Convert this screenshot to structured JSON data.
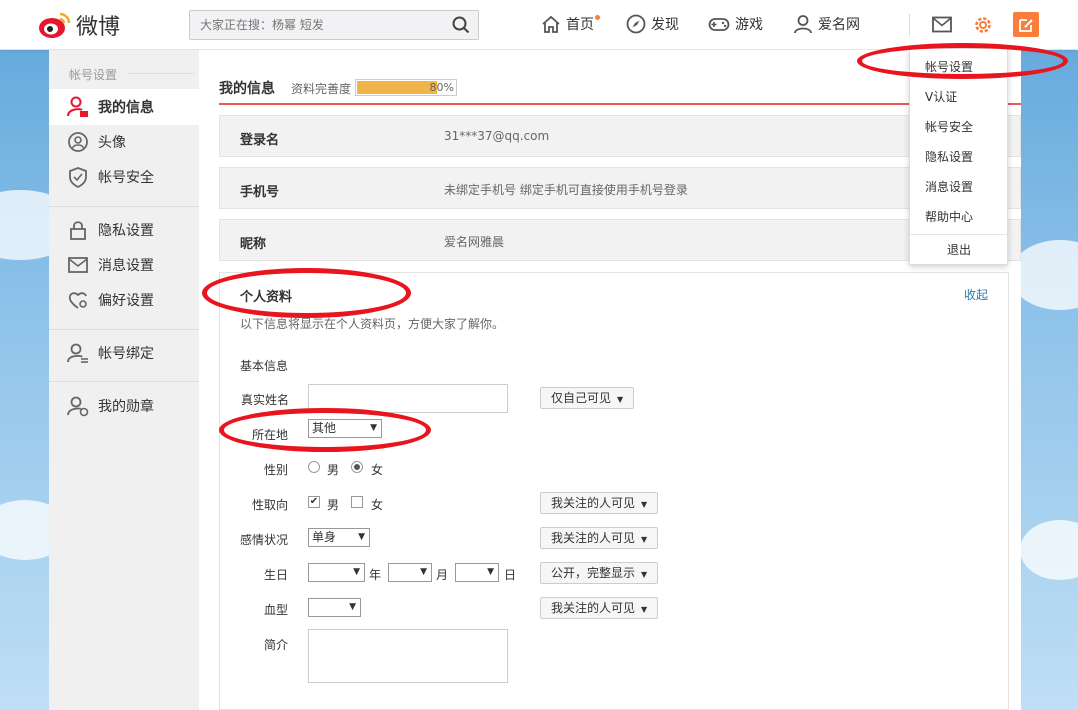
{
  "header": {
    "logo_text": "微博",
    "search_placeholder": "大家正在搜：杨幂 短发",
    "nav": {
      "home": "首页",
      "discover": "发现",
      "games": "游戏",
      "user": "爱名网"
    }
  },
  "dropdown": {
    "items": [
      "帐号设置",
      "V认证",
      "帐号安全",
      "隐私设置",
      "消息设置",
      "帮助中心"
    ],
    "logout": "退出"
  },
  "sidebar": {
    "section_title": "帐号设置",
    "items": [
      "我的信息",
      "头像",
      "帐号安全",
      "隐私设置",
      "消息设置",
      "偏好设置",
      "帐号绑定",
      "我的勋章"
    ],
    "active_index": 0
  },
  "main": {
    "title": "我的信息",
    "completeness_label": "资料完善度",
    "completeness_value": 80,
    "completeness_text": "80%",
    "login": {
      "label": "登录名",
      "value": "31***37@qq.com"
    },
    "phone": {
      "label": "手机号",
      "value": "未绑定手机号 绑定手机可直接使用手机号登录"
    },
    "nickname": {
      "label": "昵称",
      "value": "爱名网雅晨"
    }
  },
  "profile": {
    "title": "个人资料",
    "collapse": "收起",
    "description": "以下信息将显示在个人资料页，方便大家了解你。",
    "basic_info": "基本信息",
    "real_name": {
      "label": "真实姓名",
      "visibility": "仅自己可见"
    },
    "location": {
      "label": "所在地",
      "value": "其他"
    },
    "gender": {
      "label": "性别",
      "male": "男",
      "female": "女",
      "selected": "女"
    },
    "orientation": {
      "label": "性取向",
      "male": "男",
      "female": "女",
      "male_checked": true,
      "female_checked": false,
      "visibility": "我关注的人可见"
    },
    "relationship": {
      "label": "感情状况",
      "value": "单身",
      "visibility": "我关注的人可见"
    },
    "birthday": {
      "label": "生日",
      "year_unit": "年",
      "month_unit": "月",
      "day_unit": "日",
      "visibility": "公开，完整显示"
    },
    "blood": {
      "label": "血型",
      "value": "",
      "visibility": "我关注的人可见"
    },
    "bio": {
      "label": "简介"
    }
  },
  "colors": {
    "accent": "#fa7d3c",
    "annotation": "#e8141e",
    "progress": "#f0b44b"
  }
}
